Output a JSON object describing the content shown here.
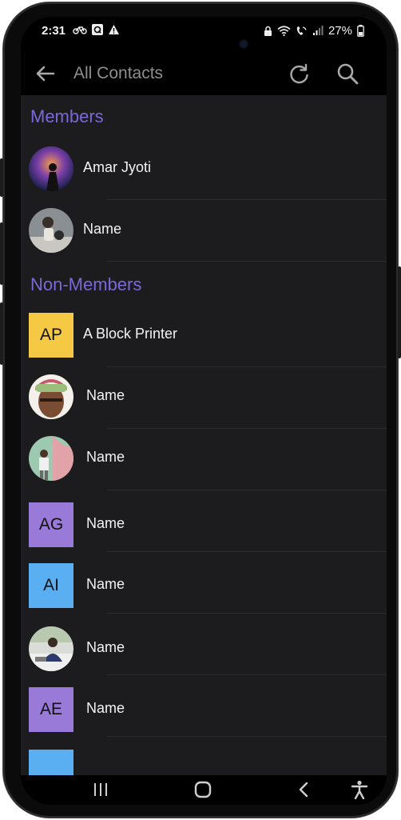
{
  "status": {
    "time": "2:31",
    "battery": "27%",
    "left_icons": [
      "bike-icon",
      "q-app-icon",
      "warning-icon"
    ],
    "right_icons": [
      "lock-icon",
      "wifi-icon",
      "call-icon",
      "signal-icon",
      "battery-icon"
    ]
  },
  "appbar": {
    "title": "All Contacts",
    "back_icon": "arrow-left-icon",
    "refresh_icon": "refresh-icon",
    "search_icon": "search-icon"
  },
  "sections": [
    {
      "title": "Members",
      "contacts": [
        {
          "name": "Amar Jyoti",
          "avatar": "photo"
        },
        {
          "name": "Name",
          "avatar": "photo"
        }
      ]
    },
    {
      "title": "Non-Members",
      "contacts": [
        {
          "name": "A Block Printer",
          "initials": "AP",
          "color": "#f6c945"
        },
        {
          "name": "Name",
          "avatar": "photo"
        },
        {
          "name": "Name",
          "avatar": "photo"
        },
        {
          "name": "Name",
          "initials": "AG",
          "color": "#9a7ad8"
        },
        {
          "name": "Name",
          "initials": "AI",
          "color": "#5aaef2"
        },
        {
          "name": "Name",
          "avatar": "photo"
        },
        {
          "name": "Name",
          "initials": "AE",
          "color": "#9a7ad8"
        },
        {
          "name": "",
          "color": "#5aaef2"
        }
      ]
    }
  ],
  "navbar": {
    "items": [
      "recent-apps-icon",
      "home-icon",
      "back-icon",
      "accessibility-icon"
    ]
  },
  "colors": {
    "background": "#1c1c1e",
    "section_title": "#7b68d8",
    "text": "#f3f3f3"
  }
}
